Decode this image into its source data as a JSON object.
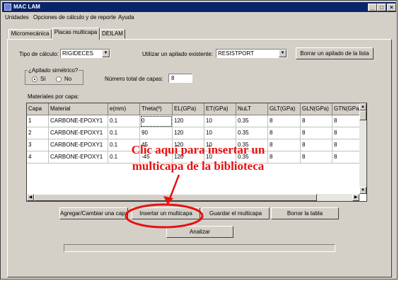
{
  "window": {
    "title": "MAC LAM",
    "icon": "app-icon"
  },
  "title_buttons": {
    "minimize": "_",
    "maximize": "□",
    "close": "×"
  },
  "menu": [
    "Unidades",
    "Opciones de cálculo y de reporte",
    "Ayuda"
  ],
  "tabs": [
    {
      "label": "Micromecánica",
      "active": false
    },
    {
      "label": "Placas multicapa",
      "active": true
    },
    {
      "label": "DEILAM",
      "active": false
    }
  ],
  "form": {
    "tipo_calculo_label": "Tipo de cálculo:",
    "tipo_calculo_value": "RIGIDECES",
    "apilado_label": "Utilizar un apilado existente:",
    "apilado_value": "RESISTPORT",
    "borrar_apilado_button": "Borrar un apilado de la lista",
    "simetrico_group": "¿Apilado simétrico?",
    "si_label": "Sí",
    "no_label": "No",
    "selected": "Sí",
    "num_capas_label": "Número total de capas:",
    "num_capas_value": "8",
    "materiales_label": "Materiales por capa:"
  },
  "table": {
    "columns": [
      "Capa",
      "Material",
      "e(mm)",
      "Theta(º)",
      "EL(GPa)",
      "ET(GPa)",
      "NuLT",
      "GLT(GPa)",
      "GLN(GPa)",
      "GTN(GPa)"
    ],
    "rows": [
      [
        "1",
        "CARBONE-EPOXY1",
        "0.1",
        "0",
        "120",
        "10",
        "0.35",
        "8",
        "8",
        "8"
      ],
      [
        "2",
        "CARBONE-EPOXY1",
        "0.1",
        "90",
        "120",
        "10",
        "0.35",
        "8",
        "8",
        "8"
      ],
      [
        "3",
        "CARBONE-EPOXY1",
        "0.1",
        "45",
        "120",
        "10",
        "0.35",
        "8",
        "8",
        "8"
      ],
      [
        "4",
        "CARBONE-EPOXY1",
        "0.1",
        "-45",
        "120",
        "10",
        "0.35",
        "8",
        "8",
        "8"
      ]
    ]
  },
  "buttons": {
    "agregar": "Agregar/Cambiar una capa",
    "insertar": "Insertar un multicapa",
    "guardar": "Guardar el multicapa",
    "borrar_tabla": "Borrar la tabla",
    "analizar": "Analizar"
  },
  "annotation": {
    "line1": "Clic aquí para insertar un",
    "line2": "multicapa de la biblioteca",
    "color": "#e81010"
  },
  "colors": {
    "titlebar": "#0a246a",
    "face": "#d4d0c8"
  }
}
